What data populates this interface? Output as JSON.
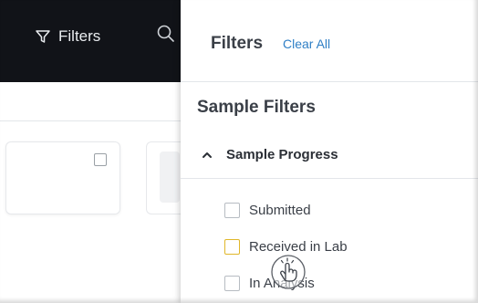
{
  "toolbar": {
    "filters_label": "Filters"
  },
  "panel": {
    "title": "Filters",
    "clear_all": "Clear All",
    "section_title": "Sample Filters",
    "group": {
      "label": "Sample Progress",
      "expanded": true,
      "options": [
        {
          "label": "Submitted",
          "checked": false
        },
        {
          "label": "Received in Lab",
          "checked": false
        },
        {
          "label": "In Analysis",
          "checked": false
        }
      ]
    }
  },
  "colors": {
    "toolbar_bg": "#111318",
    "link": "#2f7fc6",
    "hover_checkbox": "#e0b72a"
  },
  "icons": {
    "filters": "filter-funnel-icon",
    "search": "search-icon",
    "chevron": "chevron-up-icon",
    "cursor": "hand-pointer-icon"
  }
}
